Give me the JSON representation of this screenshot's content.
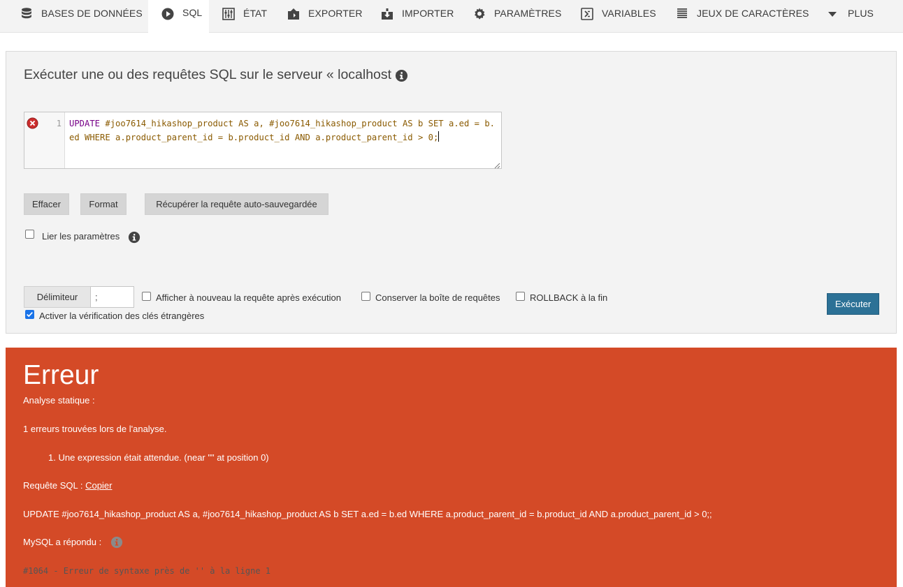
{
  "nav": {
    "tabs": [
      {
        "label": "BASES DE DONNÉES",
        "icon": "database-icon"
      },
      {
        "label": "SQL",
        "icon": "play-icon"
      },
      {
        "label": "ÉTAT",
        "icon": "status-icon"
      },
      {
        "label": "EXPORTER",
        "icon": "export-icon"
      },
      {
        "label": "IMPORTER",
        "icon": "import-icon"
      },
      {
        "label": "PARAMÈTRES",
        "icon": "gear-icon"
      },
      {
        "label": "VARIABLES",
        "icon": "variables-icon"
      },
      {
        "label": "JEUX DE CARACTÈRES",
        "icon": "list-icon"
      },
      {
        "label": "PLUS",
        "icon": "caret-down-icon"
      }
    ],
    "active": "SQL"
  },
  "query_panel": {
    "title": "Exécuter une ou des requêtes SQL sur le serveur « localhost »:",
    "editor": {
      "line_number": "1",
      "keyword": "UPDATE",
      "sql_rest": " #joo7614_hikashop_product AS a, #joo7614_hikashop_product AS b SET a.ed = b.ed WHERE a.product_parent_id = b.product_id AND a.product_parent_id > 0;"
    },
    "buttons": {
      "clear": "Effacer",
      "format": "Format",
      "recover": "Récupérer la requête auto-sauvegardée"
    },
    "bind_params": {
      "label": "Lier les paramètres",
      "checked": false
    },
    "delimiter": {
      "label": "Délimiteur",
      "value": ";"
    },
    "options": {
      "show_again": {
        "label": "Afficher à nouveau la requête après exécution",
        "checked": false
      },
      "keep_box": {
        "label": "Conserver la boîte de requêtes",
        "checked": false
      },
      "rollback": {
        "label": "ROLLBACK à la fin",
        "checked": false
      },
      "fk_check": {
        "label": "Activer la vérification des clés étrangères",
        "checked": true
      }
    },
    "execute_button": "Exécuter"
  },
  "error_panel": {
    "title": "Erreur",
    "static_analysis": "Analyse statique :",
    "errors_found": "1 erreurs trouvées lors de l'analyse.",
    "error_item": "1. Une expression était attendue. (near \"\" at position 0)",
    "sql_query_label": "Requête SQL : ",
    "copy_link": "Copier",
    "query_text": "UPDATE #joo7614_hikashop_product AS a, #joo7614_hikashop_product AS b SET a.ed = b.ed WHERE a.product_parent_id = b.product_id AND a.product_parent_id > 0;;",
    "mysql_replied": "MySQL a répondu : ",
    "mysql_error": "#1064 - Erreur de syntaxe près de '' à la ligne 1"
  },
  "colors": {
    "error_bg": "#d44a27",
    "execute_btn": "#2c7196",
    "nav_bg": "#f3f3f3"
  }
}
